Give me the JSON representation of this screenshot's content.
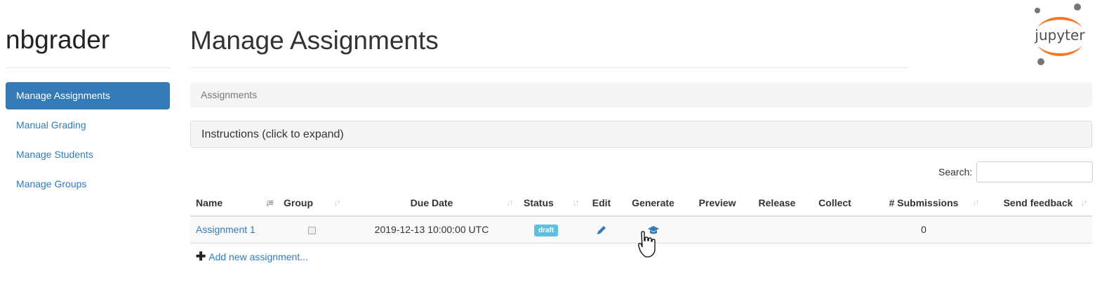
{
  "sidebar": {
    "brand": "nbgrader",
    "items": [
      {
        "label": "Manage Assignments",
        "active": true
      },
      {
        "label": "Manual Grading"
      },
      {
        "label": "Manage Students"
      },
      {
        "label": "Manage Groups"
      }
    ]
  },
  "main": {
    "title": "Manage Assignments",
    "breadcrumb": "Assignments",
    "instructions": "Instructions (click to expand)",
    "search_label": "Search:",
    "search_value": "",
    "add_link": "Add new assignment..."
  },
  "logo": {
    "text": "jupyter",
    "color": "#f37726"
  },
  "table": {
    "headers": [
      "Name",
      "Group",
      "Due Date",
      "Status",
      "Edit",
      "Generate",
      "Preview",
      "Release",
      "Collect",
      "# Submissions",
      "Send feedback"
    ],
    "rows": [
      {
        "name": "Assignment 1",
        "group_checked": false,
        "due_date": "2019-12-13 10:00:00 UTC",
        "status": "draft",
        "edit_icon": "pencil-icon",
        "generate_icon": "graduation-cap-icon",
        "submissions": "0"
      }
    ]
  },
  "colors": {
    "primary": "#337ab7",
    "badge": "#5bc0de"
  }
}
